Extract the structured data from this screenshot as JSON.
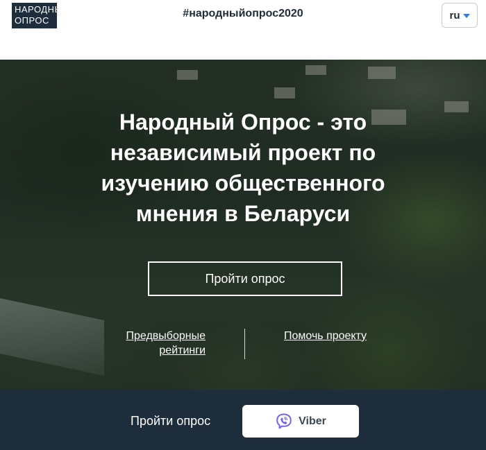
{
  "header": {
    "logo_line1": "НАРОДНЫЙ",
    "logo_line2": "ОПРОС",
    "hashtag": "#народныйопрос2020",
    "language": "ru"
  },
  "hero": {
    "title_lines": [
      "Народный Опрос - это",
      "независимый проект по",
      "изучению общественного",
      "мнения в Беларуси"
    ],
    "survey_button": "Пройти опрос",
    "ratings_link_lines": [
      "Предвыборные",
      "рейтинги"
    ],
    "help_link": "Помочь проекту"
  },
  "bottom_bar": {
    "label": "Пройти опрос",
    "viber_button": "Viber"
  },
  "colors": {
    "dark_navy": "#1e2d3b",
    "accent_blue": "#2f7ed8",
    "viber_purple": "#7360f2"
  },
  "icons": {
    "language_caret": "chevron-down-icon",
    "viber": "viber-icon"
  }
}
